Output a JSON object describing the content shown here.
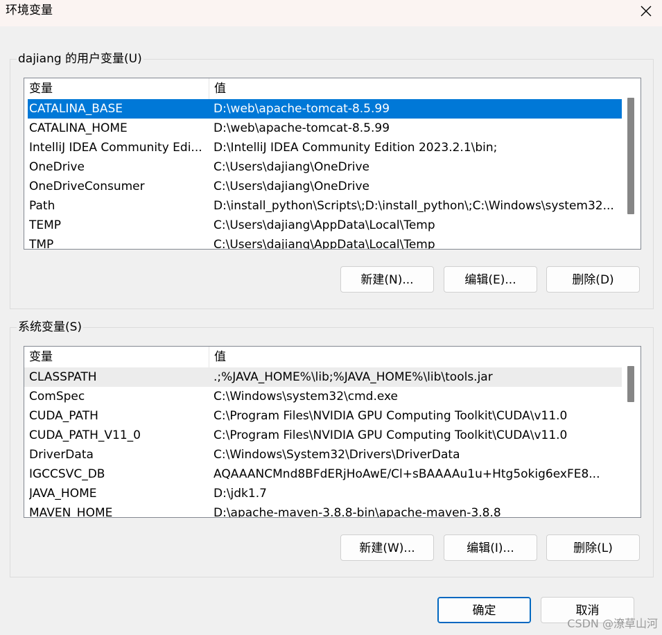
{
  "window": {
    "title": "环境变量"
  },
  "user_vars": {
    "label": "dajiang 的用户变量(U)",
    "columns": [
      "变量",
      "值"
    ],
    "rows": [
      [
        "CATALINA_BASE",
        "D:\\web\\apache-tomcat-8.5.99"
      ],
      [
        "CATALINA_HOME",
        "D:\\web\\apache-tomcat-8.5.99"
      ],
      [
        "IntelliJ IDEA Community Edi...",
        "D:\\IntelliJ IDEA Community Edition 2023.2.1\\bin;"
      ],
      [
        "OneDrive",
        "C:\\Users\\dajiang\\OneDrive"
      ],
      [
        "OneDriveConsumer",
        "C:\\Users\\dajiang\\OneDrive"
      ],
      [
        "Path",
        "D:\\install_python\\Scripts\\;D:\\install_python\\;C:\\Windows\\system32..."
      ],
      [
        "TEMP",
        "C:\\Users\\dajiang\\AppData\\Local\\Temp"
      ],
      [
        "TMP",
        "C:\\Users\\dajiang\\AppData\\Local\\Temp"
      ]
    ],
    "selected_row": "CATALINA_BASE",
    "buttons": {
      "new": "新建(N)...",
      "edit": "编辑(E)...",
      "delete": "删除(D)"
    }
  },
  "system_vars": {
    "label": "系统变量(S)",
    "columns": [
      "变量",
      "值"
    ],
    "rows": [
      [
        "CLASSPATH",
        ".;%JAVA_HOME%\\lib;%JAVA_HOME%\\lib\\tools.jar"
      ],
      [
        "ComSpec",
        "C:\\Windows\\system32\\cmd.exe"
      ],
      [
        "CUDA_PATH",
        "C:\\Program Files\\NVIDIA GPU Computing Toolkit\\CUDA\\v11.0"
      ],
      [
        "CUDA_PATH_V11_0",
        "C:\\Program Files\\NVIDIA GPU Computing Toolkit\\CUDA\\v11.0"
      ],
      [
        "DriverData",
        "C:\\Windows\\System32\\Drivers\\DriverData"
      ],
      [
        "IGCCSVC_DB",
        "AQAAANCMnd8BFdERjHoAwE/Cl+sBAAAAu1u+Htg5okig6exFE8..."
      ],
      [
        "JAVA_HOME",
        "D:\\jdk1.7"
      ],
      [
        "MAVEN_HOME",
        "D:\\apache-maven-3.8.8-bin\\apache-maven-3.8.8"
      ]
    ],
    "hovered_row": "CLASSPATH",
    "buttons": {
      "new": "新建(W)...",
      "edit": "编辑(I)...",
      "delete": "删除(L)"
    }
  },
  "footer": {
    "ok": "确定",
    "cancel": "取消"
  },
  "watermark": "CSDN @潦草山河",
  "colors": {
    "selection": "#0078d7",
    "primary_border": "#0067c0",
    "background": "#f0f0f0"
  },
  "icons": {
    "close": "close-icon"
  }
}
